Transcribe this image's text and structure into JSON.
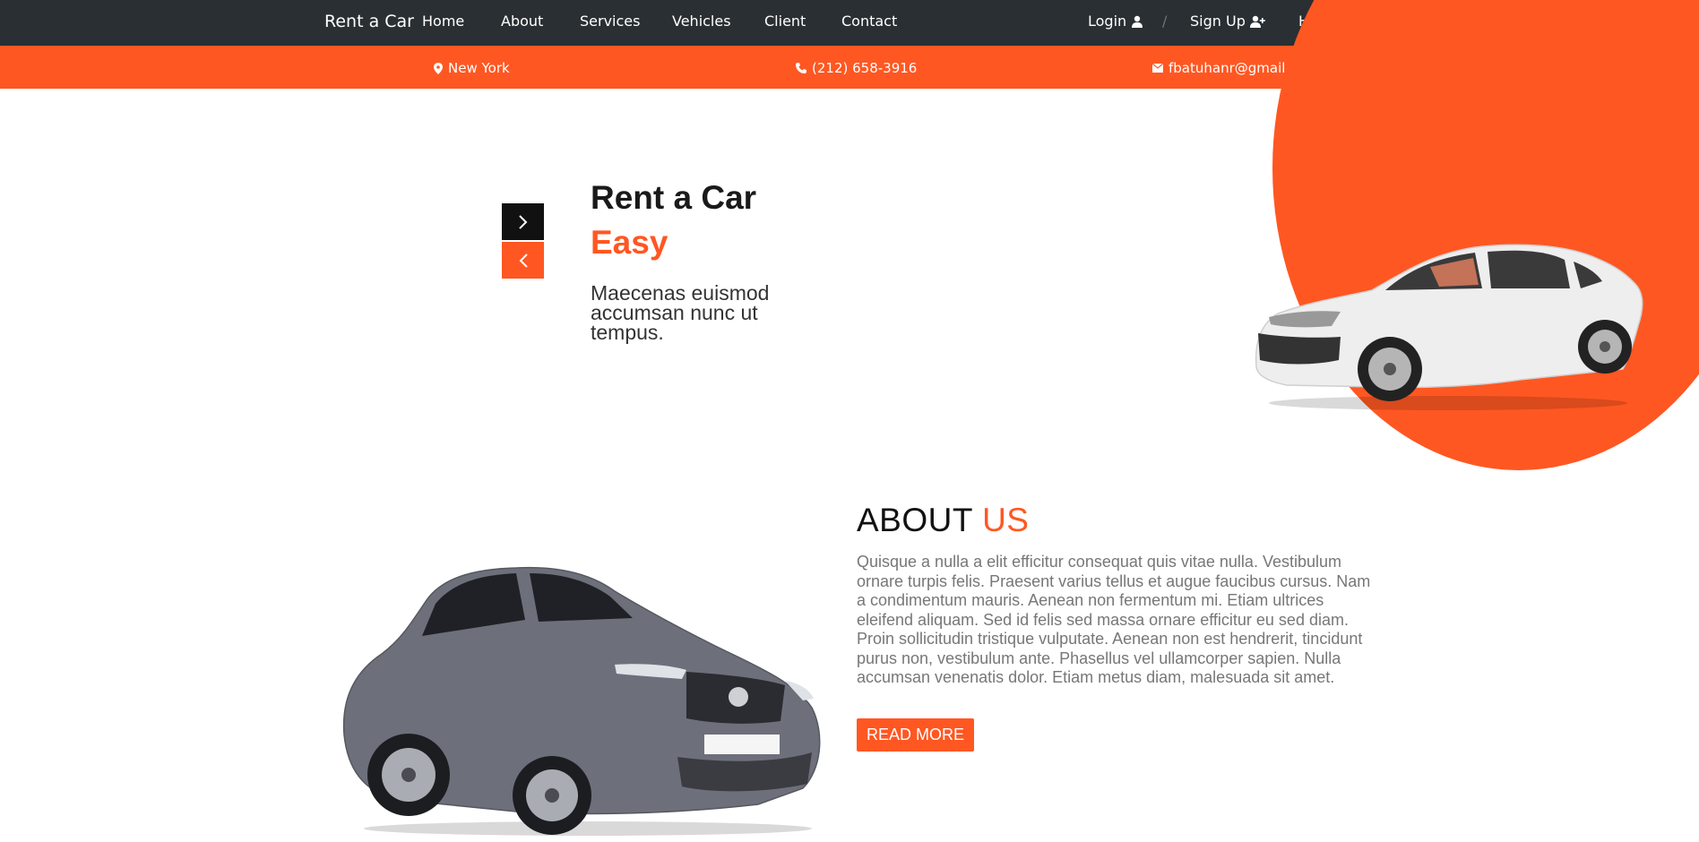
{
  "navbar": {
    "brand": "Rent a Car",
    "links": [
      "Home",
      "About",
      "Services",
      "Vehicles",
      "Client",
      "Contact"
    ],
    "login": "Login",
    "separator": "/",
    "signup": "Sign Up",
    "help": "Help",
    "icons": {
      "login": "user-icon",
      "signup": "user-plus-icon",
      "help": "help-icon"
    }
  },
  "infobar": {
    "location": "New York",
    "phone": "(212) 658-3916",
    "email": "fbatuhanr@gmail.com",
    "icons": {
      "location": "map-pin-icon",
      "phone": "phone-icon",
      "email": "envelope-icon"
    }
  },
  "hero": {
    "title": "Rent a Car",
    "accent": "Easy",
    "text": "Maecenas euismod accumsan nunc ut tempus.",
    "next_icon": "chevron-right-icon",
    "prev_icon": "chevron-left-icon"
  },
  "about": {
    "title_main": "ABOUT",
    "title_accent": "US",
    "text": "Quisque a nulla a elit efficitur consequat quis vitae nulla. Vestibulum ornare turpis felis. Praesent varius tellus et augue faucibus cursus. Nam a condimentum mauris. Aenean non fermentum mi. Etiam ultrices eleifend aliquam. Sed id felis sed massa ornare efficitur eu sed diam. Proin sollicitudin tristique vulputate. Aenean non est hendrerit, tincidunt purus non, vestibulum ante. Phasellus vel ullamcorper sapien. Nulla accumsan venenatis dolor. Etiam metus diam, malesuada sit amet.",
    "button": "READ MORE"
  },
  "colors": {
    "accent": "#ff5722",
    "navbar": "#2a2f33"
  }
}
